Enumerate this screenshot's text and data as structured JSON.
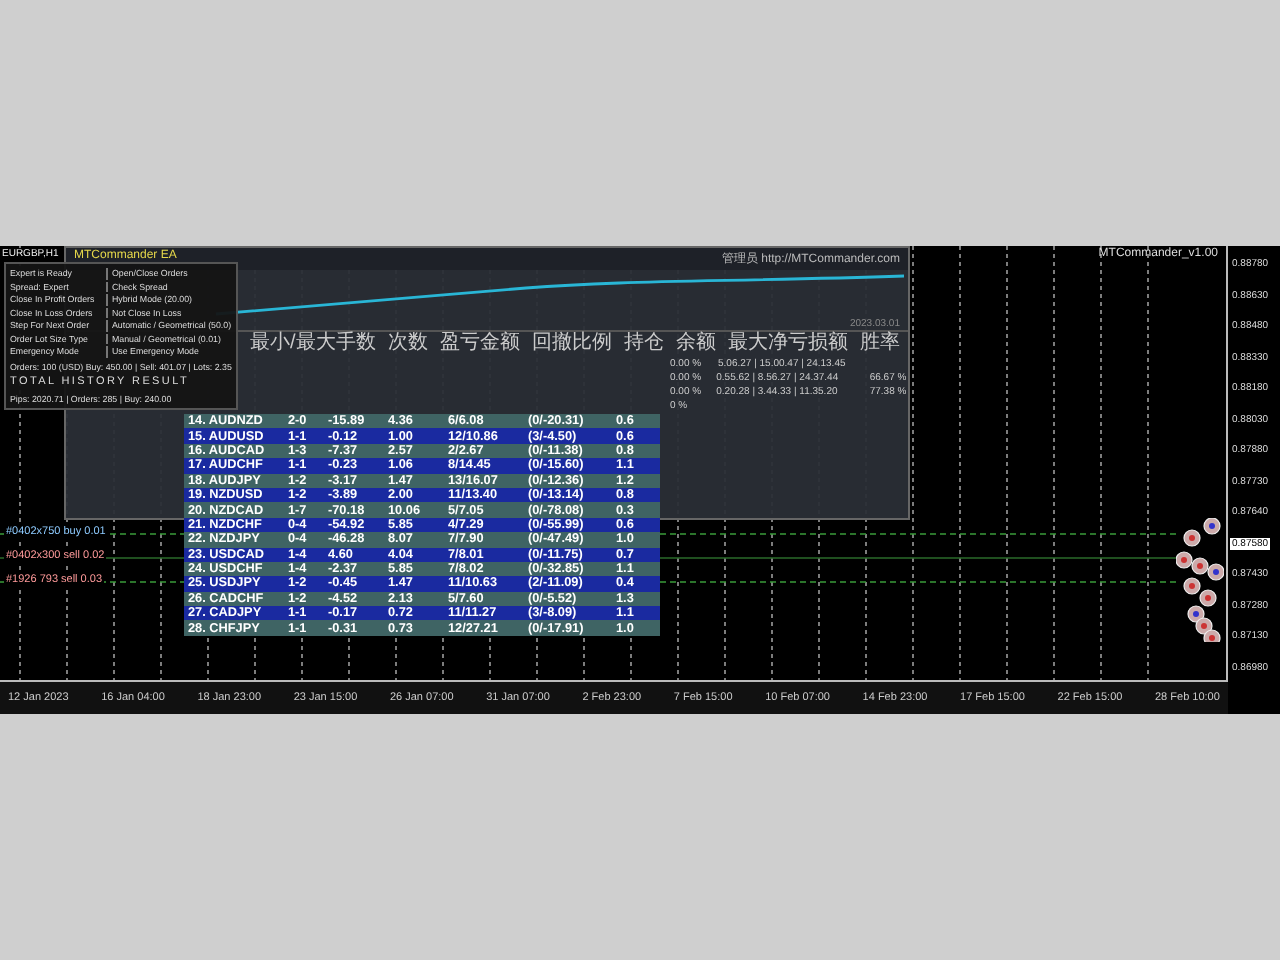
{
  "chart": {
    "symbol": "EURGBP,H1",
    "ea_label": "MTCommander_v1.00",
    "orders": [
      {
        "text": "#0402x750 buy 0.01",
        "kind": "buy"
      },
      {
        "text": "#0402x300 sell 0.02",
        "kind": "sell"
      },
      {
        "text": "#1926 793 sell 0.03",
        "kind": "sell"
      }
    ],
    "prices": [
      {
        "text": "0.88780",
        "selected": false
      },
      {
        "text": "0.88630",
        "selected": false
      },
      {
        "text": "0.88480",
        "selected": false
      },
      {
        "text": "0.88330",
        "selected": false
      },
      {
        "text": "0.88180",
        "selected": false
      },
      {
        "text": "0.88030",
        "selected": false
      },
      {
        "text": "0.87880",
        "selected": false
      },
      {
        "text": "0.87730",
        "selected": false
      },
      {
        "text": "0.87640",
        "selected": false
      },
      {
        "text": "0.87580",
        "selected": true
      },
      {
        "text": "0.87430",
        "selected": false
      },
      {
        "text": "0.87280",
        "selected": false
      },
      {
        "text": "0.87130",
        "selected": false
      },
      {
        "text": "0.86980",
        "selected": false
      }
    ],
    "times": [
      "12 Jan 2023",
      "16 Jan 04:00",
      "18 Jan 23:00",
      "23 Jan 15:00",
      "26 Jan 07:00",
      "31 Jan 07:00",
      "2 Feb 23:00",
      "7 Feb 15:00",
      "10 Feb 07:00",
      "14 Feb 23:00",
      "17 Feb 15:00",
      "22 Feb 15:00",
      "28 Feb 10:00"
    ]
  },
  "panel": {
    "title": "MTCommander EA",
    "link": "管理员 http://MTCommander.com",
    "date": "2023.03.01",
    "settings": [
      {
        "label": "Expert is Ready",
        "value": "Open/Close Orders"
      },
      {
        "label": "Spread: Expert",
        "value": "Check Spread"
      },
      {
        "label": "Close In Profit Orders",
        "value": "Hybrid Mode (20.00)"
      },
      {
        "label": "Close In Loss Orders",
        "value": "Not Close In Loss"
      },
      {
        "label": "Step For Next Order",
        "value": "Automatic / Geometrical (50.0)"
      },
      {
        "label": "Order Lot Size Type",
        "value": "Manual / Geometrical (0.01)"
      },
      {
        "label": "Emergency Mode",
        "value": "Use Emergency Mode"
      }
    ],
    "orders_summary": "Orders: 100 (USD) Buy: 450.00 | Sell: 401.07 | Lots: 2.35",
    "history_title": "TOTAL HISTORY RESULT",
    "history_line": "Pips: 2020.71 | Orders: 285 | Buy: 240.00",
    "headers": [
      "最小/最大手数",
      "次数",
      "盈亏金额",
      "回撤比例",
      "持仓",
      "余额",
      "最大净亏损额",
      "胜率"
    ],
    "stats": [
      [
        "0.00 %",
        "5.06.27 | 15.00.47 | 24.13.45"
      ],
      [
        "0.00 %",
        "0.55.62 | 8.56.27 | 24.37.44",
        "66.67 %"
      ],
      [
        "0.00 %",
        "0.20.28 | 3.44.33 | 11.35.20",
        "77.38 %"
      ],
      [
        "0 %"
      ]
    ]
  },
  "pairs": [
    [
      "14. AUDNZD",
      "2-0",
      "-15.89",
      "4.36",
      "6/6.08",
      "(0/-20.31)",
      "0.6"
    ],
    [
      "15. AUDUSD",
      "1-1",
      "-0.12",
      "1.00",
      "12/10.86",
      "(3/-4.50)",
      "0.6"
    ],
    [
      "16. AUDCAD",
      "1-3",
      "-7.37",
      "2.57",
      "2/2.67",
      "(0/-11.38)",
      "0.8"
    ],
    [
      "17. AUDCHF",
      "1-1",
      "-0.23",
      "1.06",
      "8/14.45",
      "(0/-15.60)",
      "1.1"
    ],
    [
      "18. AUDJPY",
      "1-2",
      "-3.17",
      "1.47",
      "13/16.07",
      "(0/-12.36)",
      "1.2"
    ],
    [
      "19. NZDUSD",
      "1-2",
      "-3.89",
      "2.00",
      "11/13.40",
      "(0/-13.14)",
      "0.8"
    ],
    [
      "20. NZDCAD",
      "1-7",
      "-70.18",
      "10.06",
      "5/7.05",
      "(0/-78.08)",
      "0.3"
    ],
    [
      "21. NZDCHF",
      "0-4",
      "-54.92",
      "5.85",
      "4/7.29",
      "(0/-55.99)",
      "0.6"
    ],
    [
      "22. NZDJPY",
      "0-4",
      "-46.28",
      "8.07",
      "7/7.90",
      "(0/-47.49)",
      "1.0"
    ],
    [
      "23. USDCAD",
      "1-4",
      "4.60",
      "4.04",
      "7/8.01",
      "(0/-11.75)",
      "0.7"
    ],
    [
      "24. USDCHF",
      "1-4",
      "-2.37",
      "5.85",
      "7/8.02",
      "(0/-32.85)",
      "1.1"
    ],
    [
      "25. USDJPY",
      "1-2",
      "-0.45",
      "1.47",
      "11/10.63",
      "(2/-11.09)",
      "0.4"
    ],
    [
      "26. CADCHF",
      "1-2",
      "-4.52",
      "2.13",
      "5/7.60",
      "(0/-5.52)",
      "1.3"
    ],
    [
      "27. CADJPY",
      "1-1",
      "-0.17",
      "0.72",
      "11/11.27",
      "(3/-8.09)",
      "1.1"
    ],
    [
      "28. CHFJPY",
      "1-1",
      "-0.31",
      "0.73",
      "12/27.21",
      "(0/-17.91)",
      "1.0"
    ]
  ]
}
